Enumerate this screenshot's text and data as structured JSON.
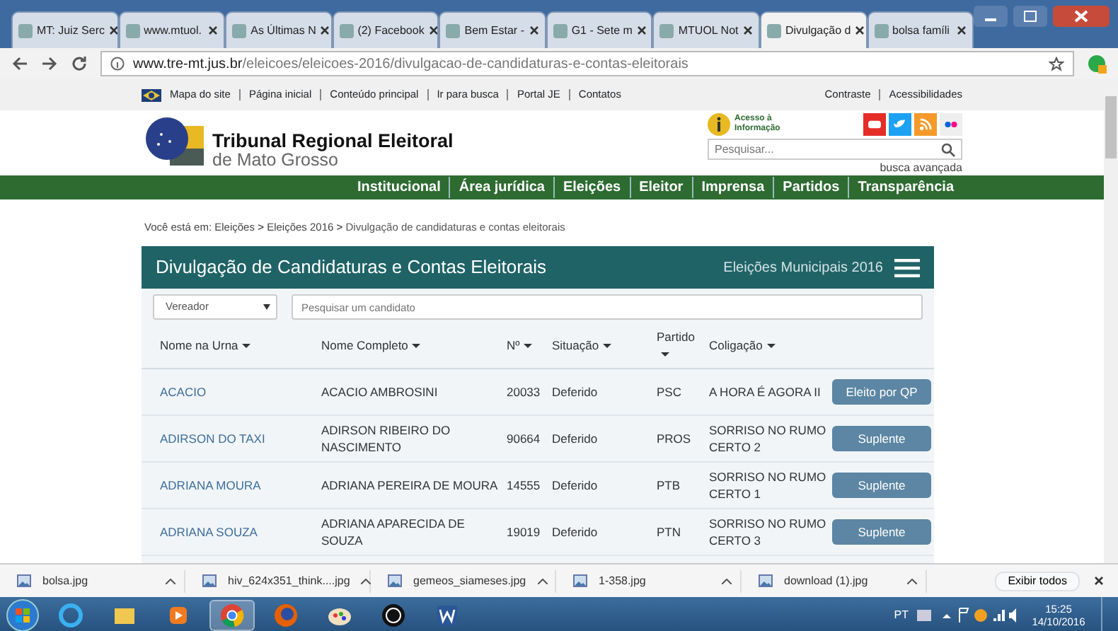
{
  "browser": {
    "tabs": [
      {
        "label": "MT: Juiz Serc",
        "selected": false
      },
      {
        "label": "www.mtuol.",
        "selected": false
      },
      {
        "label": "As Últimas N",
        "selected": false
      },
      {
        "label": "(2) Facebook",
        "selected": false
      },
      {
        "label": "Bem Estar -",
        "selected": false
      },
      {
        "label": "G1 - Sete m",
        "selected": false
      },
      {
        "label": "MTUOL Not",
        "selected": false
      },
      {
        "label": "Divulgação d",
        "selected": true
      },
      {
        "label": "bolsa famíli",
        "selected": false
      }
    ],
    "address": {
      "host": "www.tre-mt.jus.br",
      "path": "/eleicoes/eleicoes-2016/divulgacao-de-candidaturas-e-contas-eleitorais"
    }
  },
  "site": {
    "top_links": [
      "Mapa do site",
      "Página inicial",
      "Conteúdo principal",
      "Ir para busca",
      "Portal JE",
      "Contatos"
    ],
    "right_links": [
      "Contraste",
      "Acessibilidades"
    ],
    "logo": {
      "title": "Tribunal Regional Eleitoral",
      "subtitle": "de Mato Grosso"
    },
    "access": [
      "Acesso à",
      "Informação"
    ],
    "search": {
      "placeholder": "Pesquisar..."
    },
    "advanced_search": "busca avançada",
    "nav": [
      "Institucional",
      "Área jurídica",
      "Eleições",
      "Eleitor",
      "Imprensa",
      "Partidos",
      "Transparência"
    ],
    "breadcrumb": {
      "prefix": "Você está em:",
      "items": [
        {
          "kind": "link",
          "text": "Eleições"
        },
        {
          "kind": "separator",
          "text": ">"
        },
        {
          "kind": "link",
          "text": "Eleições 2016"
        },
        {
          "kind": "separator",
          "text": ">"
        },
        {
          "kind": "current",
          "text": "Divulgação de candidaturas e contas eleitorais"
        }
      ]
    }
  },
  "panel": {
    "title": "Divulgação de Candidaturas e Contas Eleitorais",
    "subtitle": "Eleições Municipais 2016",
    "filter": "Vereador",
    "search": {
      "placeholder": "Pesquisar um candidato"
    },
    "columns": [
      "Nome na Urna",
      "Nome Completo",
      "Nº",
      "Situação",
      "Partido",
      "Coligação"
    ],
    "rows": [
      {
        "name": "ACACIO",
        "full_name": "ACACIO AMBROSINI",
        "number": "20033",
        "status": "Deferido",
        "party": "PSC",
        "coalition": "A HORA É AGORA II",
        "result": "Eleito por QP"
      },
      {
        "name": "ADIRSON DO TAXI",
        "full_name": "ADIRSON RIBEIRO DO NASCIMENTO",
        "number": "90664",
        "status": "Deferido",
        "party": "PROS",
        "coalition": "SORRISO NO RUMO CERTO 2",
        "result": "Suplente"
      },
      {
        "name": "ADRIANA MOURA",
        "full_name": "ADRIANA PEREIRA DE MOURA",
        "number": "14555",
        "status": "Deferido",
        "party": "PTB",
        "coalition": "SORRISO NO RUMO CERTO 1",
        "result": "Suplente"
      },
      {
        "name": "ADRIANA SOUZA",
        "full_name": "ADRIANA APARECIDA DE SOUZA",
        "number": "19019",
        "status": "Deferido",
        "party": "PTN",
        "coalition": "SORRISO NO RUMO CERTO 3",
        "result": "Suplente"
      }
    ]
  },
  "downloads": {
    "files": [
      "bolsa.jpg",
      "hiv_624x351_think....jpg",
      "gemeos_siameses.jpg",
      "1-358.jpg",
      "download (1).jpg"
    ],
    "show_all": "Exibir todos"
  },
  "taskbar": {
    "language": "PT",
    "time": "15:25",
    "date": "14/10/2016"
  }
}
